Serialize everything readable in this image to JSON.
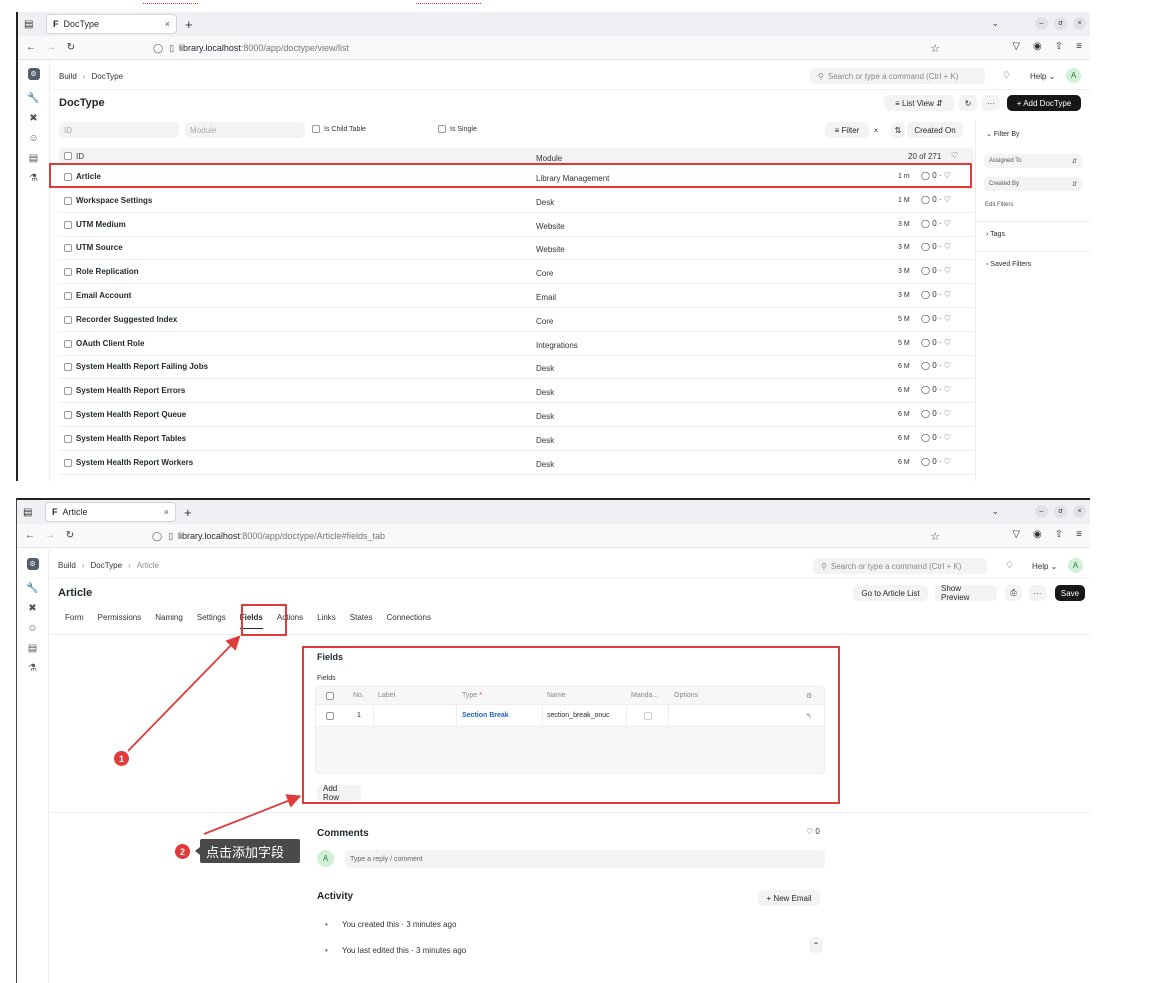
{
  "shot1": {
    "browser_tab": "DocType",
    "url_host": "library.localhost",
    "url_path": ":8000/app/doctype/view/list",
    "breadcrumb": [
      "Build",
      "DocType"
    ],
    "search_placeholder": "Search or type a command (Ctrl + K)",
    "help_label": "Help",
    "avatar_initial": "A",
    "page_title": "DocType",
    "list_view_label": "List View",
    "add_button": "+ Add DocType",
    "filters": {
      "id_placeholder": "ID",
      "module_placeholder": "Module",
      "is_child_table": "Is Child Table",
      "is_single": "Is Single",
      "filter_label": "Filter",
      "sort_label": "Created On"
    },
    "list_header": {
      "id": "ID",
      "module": "Module",
      "count": "20 of 271"
    },
    "rows": [
      {
        "name": "Article",
        "module": "Library Management",
        "time": "1 m",
        "comments": "0"
      },
      {
        "name": "Workspace Settings",
        "module": "Desk",
        "time": "1 M",
        "comments": "0"
      },
      {
        "name": "UTM Medium",
        "module": "Website",
        "time": "3 M",
        "comments": "0"
      },
      {
        "name": "UTM Source",
        "module": "Website",
        "time": "3 M",
        "comments": "0"
      },
      {
        "name": "Role Replication",
        "module": "Core",
        "time": "3 M",
        "comments": "0"
      },
      {
        "name": "Email Account",
        "module": "Email",
        "time": "3 M",
        "comments": "0"
      },
      {
        "name": "Recorder Suggested Index",
        "module": "Core",
        "time": "5 M",
        "comments": "0"
      },
      {
        "name": "OAuth Client Role",
        "module": "Integrations",
        "time": "5 M",
        "comments": "0"
      },
      {
        "name": "System Health Report Failing Jobs",
        "module": "Desk",
        "time": "6 M",
        "comments": "0"
      },
      {
        "name": "System Health Report Errors",
        "module": "Desk",
        "time": "6 M",
        "comments": "0"
      },
      {
        "name": "System Health Report Queue",
        "module": "Desk",
        "time": "6 M",
        "comments": "0"
      },
      {
        "name": "System Health Report Tables",
        "module": "Desk",
        "time": "6 M",
        "comments": "0"
      },
      {
        "name": "System Health Report Workers",
        "module": "Desk",
        "time": "6 M",
        "comments": "0"
      }
    ],
    "sidebar": {
      "filter_by": "Filter By",
      "assigned_to": "Assigned To",
      "created_by": "Created By",
      "edit_filters": "Edit Filters",
      "tags": "Tags",
      "saved_filters": "Saved Filters"
    }
  },
  "shot2": {
    "browser_tab": "Article",
    "url_host": "library.localhost",
    "url_path": ":8000/app/doctype/Article#fields_tab",
    "breadcrumb": [
      "Build",
      "DocType",
      "Article"
    ],
    "search_placeholder": "Search or type a command (Ctrl + K)",
    "help_label": "Help",
    "avatar_initial": "A",
    "page_title": "Article",
    "go_to_list": "Go to Article List",
    "show_preview": "Show Preview",
    "save": "Save",
    "tabs": [
      "Form",
      "Permissions",
      "Naming",
      "Settings",
      "Fields",
      "Actions",
      "Links",
      "States",
      "Connections"
    ],
    "fields_section_title": "Fields",
    "fields_grid_label": "Fields",
    "grid_columns": {
      "no": "No.",
      "label": "Label",
      "type": "Type",
      "type_required": "*",
      "name": "Name",
      "mandatory": "Manda...",
      "options": "Options"
    },
    "grid_row": {
      "no": "1",
      "label": "",
      "type": "Section Break",
      "name": "section_break_onuc"
    },
    "add_row": "Add Row",
    "comments_title": "Comments",
    "comments_count": "0",
    "reply_placeholder": "Type a reply / comment",
    "activity_title": "Activity",
    "new_email": "+ New Email",
    "activities": [
      "You created this · 3 minutes ago",
      "You last edited this · 3 minutes ago"
    ]
  },
  "annotations": {
    "step1": "1",
    "step2": "2",
    "tooltip": "点击添加字段",
    "color": "#e03a3a"
  }
}
